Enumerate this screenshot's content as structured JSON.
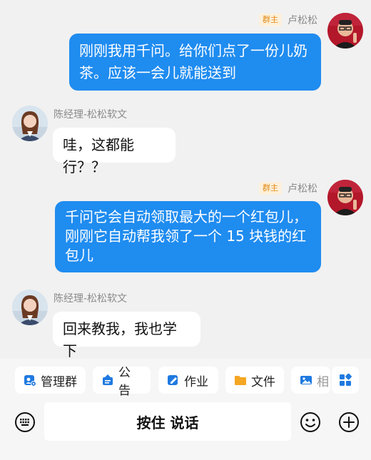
{
  "messages": [
    {
      "side": "right",
      "sender": "卢松松",
      "badge": "群主",
      "text_lines": [
        "刚刚我用千问。给你们点了一份儿奶",
        "茶。应该一会儿就能送到"
      ]
    },
    {
      "side": "left",
      "sender": "陈经理-松松软文",
      "text_lines": [
        "哇，这都能行？？"
      ]
    },
    {
      "side": "right",
      "sender": "卢松松",
      "badge": "群主",
      "text_lines": [
        "千问它会自动领取最大的一个红包儿，",
        "刚刚它自动帮我领了一个 15 块钱的红",
        "包儿"
      ]
    },
    {
      "side": "left",
      "sender": "陈经理-松松软文",
      "text_lines": [
        "回来教我，我也学下"
      ]
    }
  ],
  "toolbar": {
    "items": [
      {
        "label": "管理群",
        "icon": "manage-group-icon"
      },
      {
        "label": "公告",
        "icon": "announcement-icon"
      },
      {
        "label": "作业",
        "icon": "homework-icon"
      },
      {
        "label": "文件",
        "icon": "folder-icon"
      },
      {
        "label": "相",
        "icon": "image-icon"
      }
    ],
    "more_icon": "apps-grid-icon"
  },
  "input": {
    "hold_to_talk": "按住 说话",
    "left_icon": "keyboard-icon",
    "emoji_icon": "emoji-icon",
    "plus_icon": "plus-icon"
  },
  "colors": {
    "bubble_blue": "#1f8cf0",
    "bubble_white": "#ffffff",
    "badge_text": "#e08a16",
    "badge_bg": "#fdf0db",
    "chip_icon": "#1f7ae0"
  }
}
